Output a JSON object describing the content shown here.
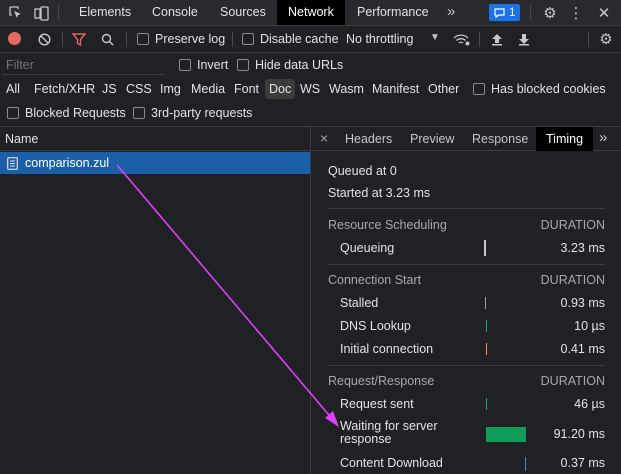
{
  "topbar": {
    "tabs": [
      "Elements",
      "Console",
      "Sources",
      "Network",
      "Performance"
    ],
    "active_tab": "Network",
    "more": "»",
    "issues_count": "1",
    "icons": [
      "inspect-icon",
      "device-toolbar-icon",
      "issues-icon",
      "gear-icon",
      "kebab-menu-icon",
      "close-icon"
    ]
  },
  "toolbar": {
    "preserve_log": "Preserve log",
    "disable_cache": "Disable cache",
    "throttling": "No throttling",
    "icons": [
      "record-icon",
      "clear-icon",
      "filter-icon",
      "search-icon",
      "wifi-settings-icon",
      "upload-icon",
      "download-icon",
      "gear-icon"
    ]
  },
  "filterbar": {
    "placeholder": "Filter",
    "invert": "Invert",
    "hide_data_urls": "Hide data URLs"
  },
  "types": {
    "items": [
      "All",
      "Fetch/XHR",
      "JS",
      "CSS",
      "Img",
      "Media",
      "Font",
      "Doc",
      "WS",
      "Wasm",
      "Manifest",
      "Other"
    ],
    "active": "Doc",
    "has_blocked_cookies": "Has blocked cookies",
    "blocked_requests": "Blocked Requests",
    "third_party": "3rd-party requests"
  },
  "requests": {
    "header": "Name",
    "rows": [
      {
        "name": "comparison.zul"
      }
    ]
  },
  "detail": {
    "close": "×",
    "tabs": [
      "Headers",
      "Preview",
      "Response",
      "Timing"
    ],
    "active_tab": "Timing",
    "more": "»"
  },
  "timing": {
    "queued_at": "Queued at 0",
    "started_at": "Started at 3.23 ms",
    "duration_label": "DURATION",
    "sections": [
      {
        "title": "Resource Scheduling",
        "rows": [
          {
            "label": "Queueing",
            "value": "3.23 ms",
            "color": "#c7c7c7"
          }
        ]
      },
      {
        "title": "Connection Start",
        "rows": [
          {
            "label": "Stalled",
            "value": "0.93 ms",
            "color": "#c7c7c7"
          },
          {
            "label": "DNS Lookup",
            "value": "10 µs",
            "color": "#1f9e89"
          },
          {
            "label": "Initial connection",
            "value": "0.41 ms",
            "color": "#f29900"
          }
        ]
      },
      {
        "title": "Request/Response",
        "rows": [
          {
            "label": "Request sent",
            "value": "46 µs",
            "color": "#1f9e89"
          },
          {
            "label": "Waiting for server response",
            "value": "91.20 ms",
            "color": "#0f9d58"
          },
          {
            "label": "Content Download",
            "value": "0.37 ms",
            "color": "#4285f4"
          }
        ]
      }
    ]
  },
  "annotation": {
    "arrow_color": "#e040fb"
  }
}
